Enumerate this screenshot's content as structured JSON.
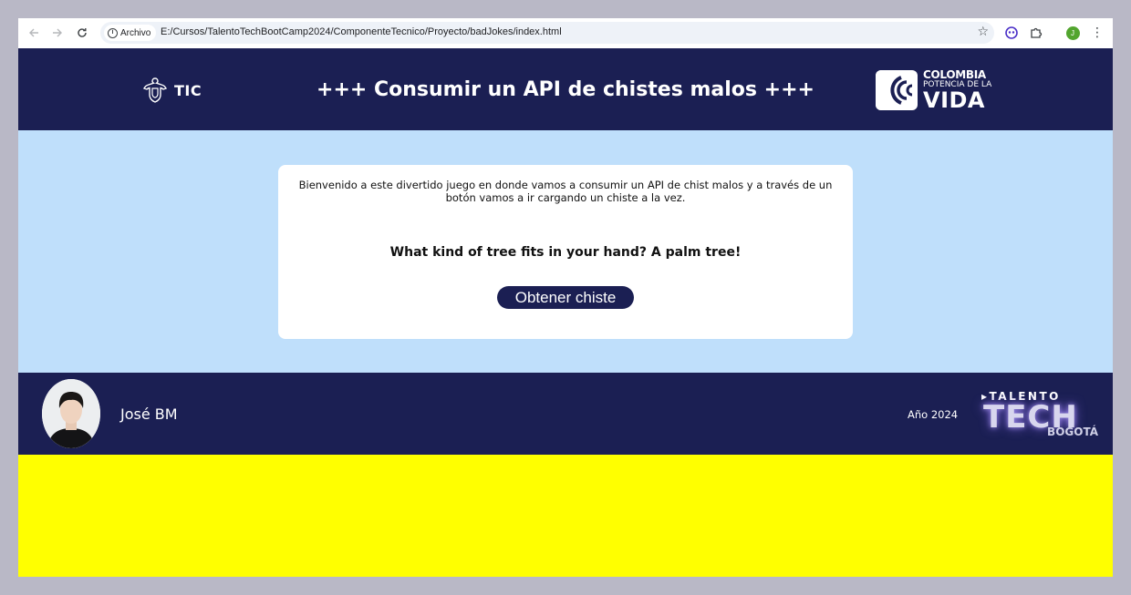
{
  "browser": {
    "back_icon": "arrow-left-icon",
    "forward_icon": "arrow-right-icon",
    "reload_icon": "reload-icon",
    "site_label": "Archivo",
    "url": "E:/Cursos/TalentoTechBootCamp2024/ComponenteTecnico/Proyecto/badJokes/index.html",
    "profile_initial": "J"
  },
  "header": {
    "tic_label": "TIC",
    "title": "+++ Consumir un API de chistes malos +++",
    "colombia_line1": "COLOMBIA",
    "colombia_line2": "POTENCIA DE LA",
    "colombia_line3": "VIDA"
  },
  "main": {
    "intro": "Bienvenido a este divertido juego en donde vamos a consumir un API de chist malos y a través de un botón vamos a ir cargando un chiste a la vez.",
    "joke": "What kind of tree fits in your hand? A palm tree!",
    "button_label": "Obtener chiste"
  },
  "footer": {
    "author": "José BM",
    "year": "Año 2024",
    "logo_line1": "TALENTO",
    "logo_line2": "TECH",
    "logo_line3": "BOGOTÁ"
  },
  "colors": {
    "navy": "#1b1f53",
    "light_blue": "#bfdffb",
    "yellow": "#ffff00"
  }
}
